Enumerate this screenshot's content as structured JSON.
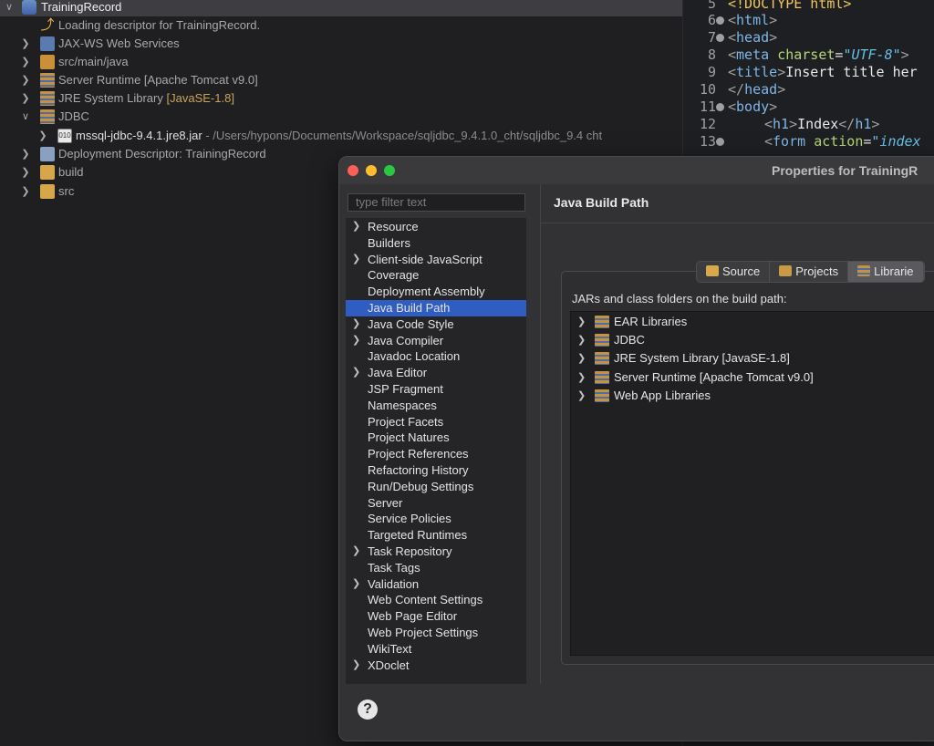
{
  "explorer": {
    "items": [
      {
        "label": "TrainingRecord",
        "icon": "project-icon",
        "twisty": "expanded"
      },
      {
        "label": "Loading descriptor for TrainingRecord.",
        "icon": "loading-arrow-icon",
        "twisty": ""
      },
      {
        "label": "JAX-WS Web Services",
        "icon": "web-services-icon",
        "twisty": "collapsed"
      },
      {
        "label": "src/main/java",
        "icon": "source-folder-icon",
        "twisty": "collapsed"
      },
      {
        "label": "Server Runtime [Apache Tomcat v9.0]",
        "icon": "library-icon",
        "twisty": "collapsed"
      },
      {
        "label": "JRE System Library",
        "extra": "[JavaSE-1.8]",
        "icon": "library-icon",
        "twisty": "collapsed"
      },
      {
        "label": "JDBC",
        "icon": "library-icon",
        "twisty": "expanded"
      },
      {
        "label": "mssql-jdbc-9.4.1.jre8.jar",
        "extra": " - /Users/hypons/Documents/Workspace/sqljdbc_9.4.1.0_cht/sqljdbc_9.4 cht",
        "icon": "jar-icon",
        "twisty": "collapsed"
      },
      {
        "label": "Deployment Descriptor: TrainingRecord",
        "icon": "deployment-descriptor-icon",
        "twisty": "collapsed"
      },
      {
        "label": "build",
        "icon": "folder-icon",
        "twisty": "collapsed"
      },
      {
        "label": "src",
        "icon": "folder-icon",
        "twisty": "collapsed"
      }
    ]
  },
  "editor": {
    "lines": [
      {
        "num": "5",
        "fold": false
      },
      {
        "num": "6",
        "fold": true
      },
      {
        "num": "7",
        "fold": true
      },
      {
        "num": "8",
        "fold": false
      },
      {
        "num": "9",
        "fold": false
      },
      {
        "num": "10",
        "fold": false
      },
      {
        "num": "11",
        "fold": true
      },
      {
        "num": "12",
        "fold": false
      },
      {
        "num": "13",
        "fold": true
      }
    ],
    "code": {
      "l5_doctype": "<!DOCTYPE html>",
      "l6_tag": "html",
      "l7_tag": "head",
      "l8_tag": "meta",
      "l8_attr": "charset",
      "l8_val": "\"UTF-8\"",
      "l9_tag": "title",
      "l9_text": "Insert title her",
      "l10_tag": "head",
      "l11_tag": "body",
      "l12_tag": "h1",
      "l12_text": "Index",
      "l13_tag": "form",
      "l13_attr": "action",
      "l13_val": "\"index"
    }
  },
  "dialog": {
    "title": "Properties for TrainingR",
    "filter_placeholder": "type filter text",
    "nav_items": [
      {
        "label": "Resource",
        "expandable": true
      },
      {
        "label": "Builders",
        "expandable": false
      },
      {
        "label": "Client-side JavaScript",
        "expandable": true
      },
      {
        "label": "Coverage",
        "expandable": false
      },
      {
        "label": "Deployment Assembly",
        "expandable": false
      },
      {
        "label": "Java Build Path",
        "expandable": false,
        "selected": true
      },
      {
        "label": "Java Code Style",
        "expandable": true
      },
      {
        "label": "Java Compiler",
        "expandable": true
      },
      {
        "label": "Javadoc Location",
        "expandable": false
      },
      {
        "label": "Java Editor",
        "expandable": true
      },
      {
        "label": "JSP Fragment",
        "expandable": false
      },
      {
        "label": "Namespaces",
        "expandable": false
      },
      {
        "label": "Project Facets",
        "expandable": false
      },
      {
        "label": "Project Natures",
        "expandable": false
      },
      {
        "label": "Project References",
        "expandable": false
      },
      {
        "label": "Refactoring History",
        "expandable": false
      },
      {
        "label": "Run/Debug Settings",
        "expandable": false
      },
      {
        "label": "Server",
        "expandable": false
      },
      {
        "label": "Service Policies",
        "expandable": false
      },
      {
        "label": "Targeted Runtimes",
        "expandable": false
      },
      {
        "label": "Task Repository",
        "expandable": true
      },
      {
        "label": "Task Tags",
        "expandable": false
      },
      {
        "label": "Validation",
        "expandable": true
      },
      {
        "label": "Web Content Settings",
        "expandable": false
      },
      {
        "label": "Web Page Editor",
        "expandable": false
      },
      {
        "label": "Web Project Settings",
        "expandable": false
      },
      {
        "label": "WikiText",
        "expandable": false
      },
      {
        "label": "XDoclet",
        "expandable": true
      }
    ],
    "content_title": "Java Build Path",
    "tabs": [
      {
        "label": "Source",
        "icon": "source-tab-icon"
      },
      {
        "label": "Projects",
        "icon": "projects-tab-icon"
      },
      {
        "label": "Librarie",
        "icon": "libraries-tab-icon",
        "active": true
      }
    ],
    "build_path_label": "JARs and class folders on the build path:",
    "libraries": [
      {
        "label": "EAR Libraries"
      },
      {
        "label": "JDBC"
      },
      {
        "label": "JRE System Library [JavaSE-1.8]"
      },
      {
        "label": "Server Runtime [Apache Tomcat v9.0]"
      },
      {
        "label": "Web App Libraries"
      }
    ],
    "help_icon": "?"
  }
}
